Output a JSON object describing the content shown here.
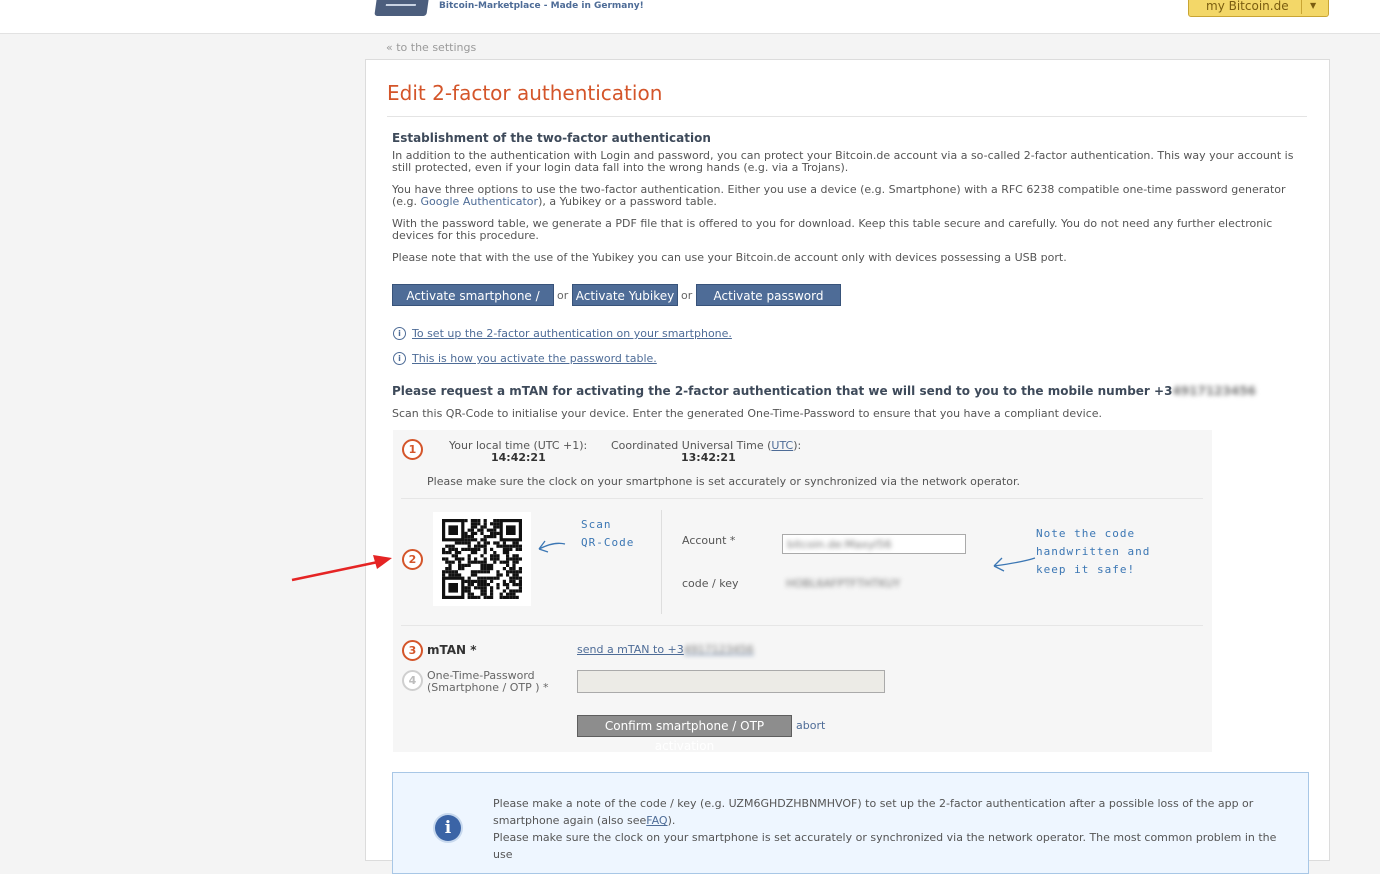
{
  "header": {
    "tagline": "Bitcoin-Marketplace - Made in Germany!",
    "account_menu": "my Bitcoin.de"
  },
  "back_link": "« to the settings",
  "title": "Edit 2-factor authentication",
  "intro": {
    "heading": "Establishment of the two-factor authentication",
    "p1": "In addition to the authentication with Login and password, you can protect your Bitcoin.de account via a so-called 2-factor authentication. This way your account is still protected, even if your login data fall into the wrong hands (e.g. via a Trojans).",
    "p2_before": "You have three options to use the two-factor authentication. Either you use a device (e.g. Smartphone) with a RFC 6238 compatible one-time password generator (e.g. ",
    "p2_link": "Google Authenticator",
    "p2_after": "), a Yubikey or a password table.",
    "p3": "With the password table, we generate a PDF file that is offered to you for download. Keep this table secure and carefully. You do not need any further electronic devices for this procedure.",
    "p4": "Please note that with the use of the Yubikey you can use your Bitcoin.de account only with devices possessing a USB port."
  },
  "options": {
    "smartphone": "Activate smartphone / OTP",
    "or": "or",
    "yubikey": "Activate Yubikey",
    "password_table": "Activate password table"
  },
  "help_links": {
    "smartphone": "To set up the 2-factor authentication on your smartphone.",
    "password_table": "This is how you activate the password table."
  },
  "mtan_request": {
    "text": "Please request a mTAN for activating the 2-factor authentication that we will send to you to the mobile number +3",
    "number_blurred": "4917123456"
  },
  "scan_instruction": "Scan this QR-Code to initialise your device. Enter the generated One-Time-Password to ensure that you have a compliant device.",
  "step1": {
    "num": "1",
    "local_label": "Your local time (UTC +1):",
    "local_time": "14:42:21",
    "utc_label_before": "Coordinated Universal Time (",
    "utc_link": "UTC",
    "utc_label_after": "):",
    "utc_time": "13:42:21",
    "note": "Please make sure the clock on your smartphone is set accurately or synchronized via the network operator."
  },
  "step2": {
    "num": "2",
    "scan_note": "Scan\nQR-Code",
    "account_label": "Account *",
    "account_value": "bitcoin.de:MaxyI56",
    "code_label": "code / key",
    "code_value": "HOBL6AFPTFTHTKUY",
    "keep_note": "Note the code\nhandwritten and\nkeep it safe!"
  },
  "step3": {
    "num": "3",
    "label": "mTAN *",
    "send_link": "send a mTAN to +3",
    "send_blurred": "4917123456"
  },
  "step4": {
    "num": "4",
    "label": "One-Time-Password\n(Smartphone / OTP ) *",
    "value": "",
    "confirm": "Confirm smartphone / OTP activation",
    "abort": "abort"
  },
  "info": {
    "line1_before": "Please make a note of the code / key (e.g. UZM6GHDZHBNMHVOF) to set up the 2-factor authentication after a possible loss of the app or smartphone again (also see",
    "faq_link": "FAQ",
    "line1_after": ").",
    "line2": "Please make sure the clock on your smartphone is set accurately or synchronized via the network operator. The most common problem in the use"
  },
  "colors": {
    "accent_orange": "#d4552a",
    "button_blue": "#4e6c97",
    "handwriting_blue": "#3c77b4",
    "arrow_red": "#e52424"
  }
}
